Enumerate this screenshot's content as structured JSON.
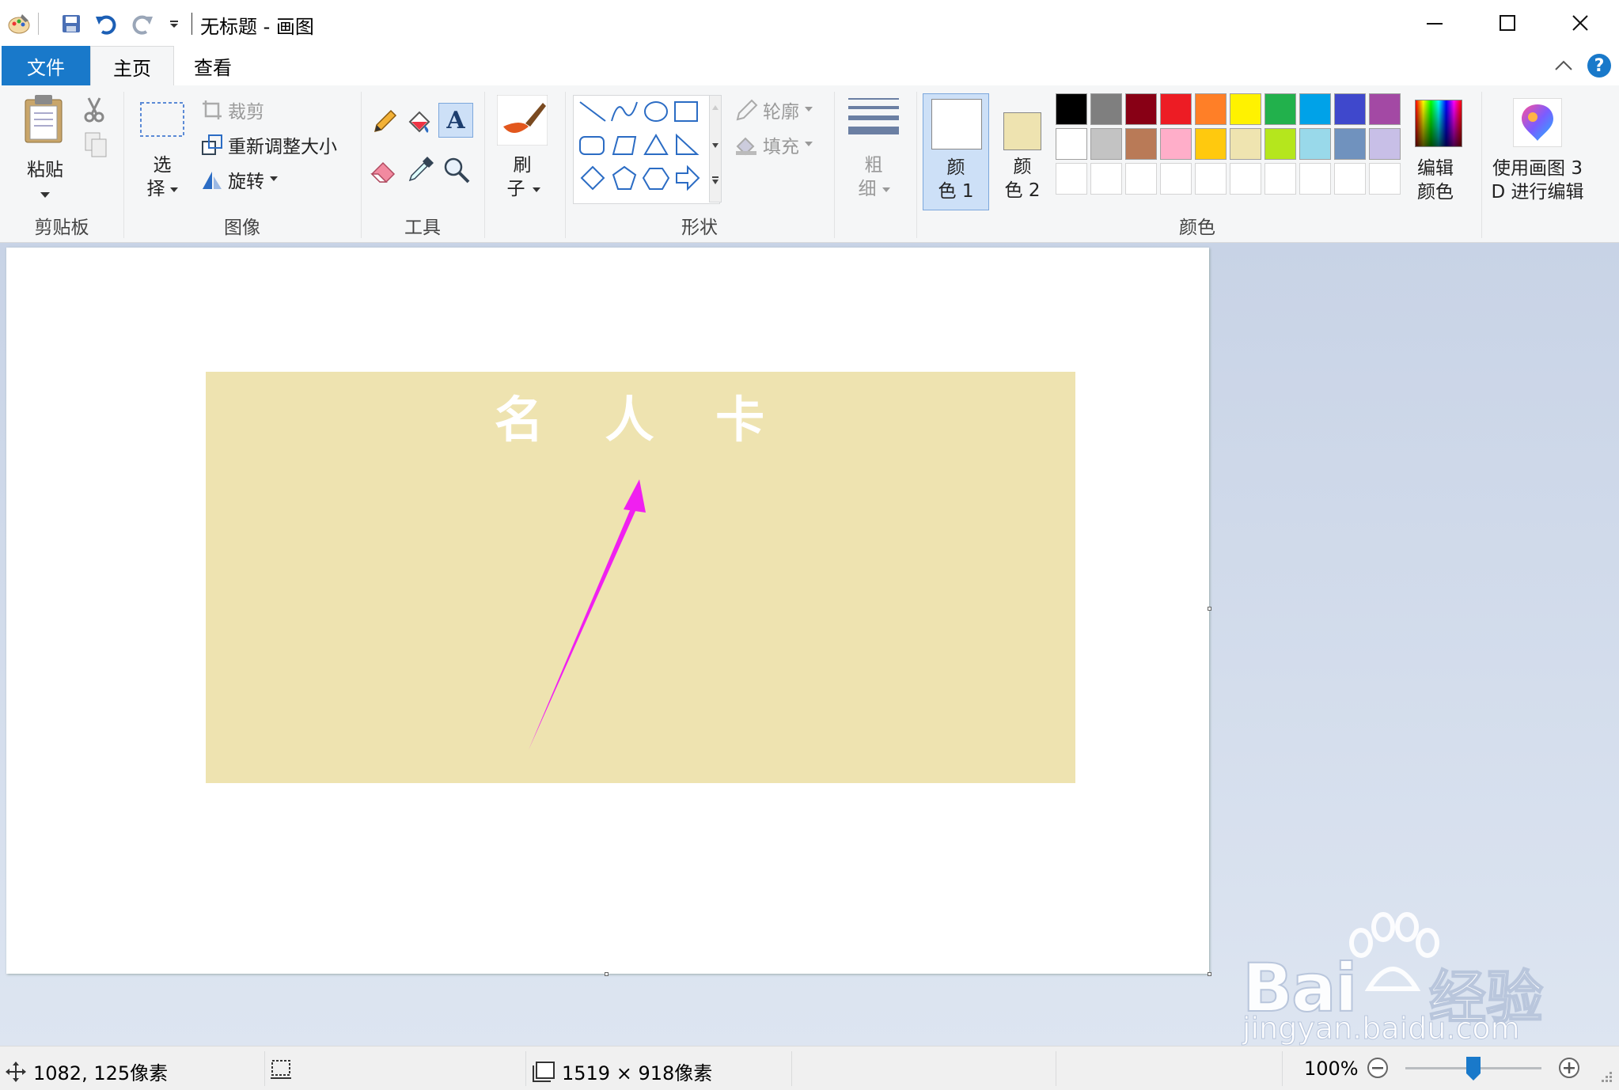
{
  "window": {
    "title": "无标题 - 画图"
  },
  "tabs": {
    "file": "文件",
    "home": "主页",
    "view": "查看"
  },
  "ribbon": {
    "clipboard": {
      "paste": "粘贴",
      "group": "剪贴板"
    },
    "image": {
      "select_1": "选",
      "select_2": "择",
      "crop": "裁剪",
      "resize": "重新调整大小",
      "rotate": "旋转",
      "group": "图像"
    },
    "tools": {
      "group": "工具"
    },
    "brushes": {
      "label_1": "刷",
      "label_2": "子"
    },
    "shapes": {
      "outline": "轮廓",
      "fill": "填充",
      "group": "形状"
    },
    "size": {
      "label_1": "粗",
      "label_2": "细"
    },
    "colors": {
      "color1_1": "颜",
      "color1_2": "色 1",
      "color2_1": "颜",
      "color2_2": "色 2",
      "edit_1": "编辑",
      "edit_2": "颜色",
      "group": "颜色",
      "color1_value": "#ffffff",
      "color2_value": "#eee3b0",
      "palette_row1": [
        "#000000",
        "#7f7f7f",
        "#880015",
        "#ed1c24",
        "#ff7f27",
        "#fff200",
        "#22b14c",
        "#00a2e8",
        "#3f48cc",
        "#a349a4"
      ],
      "palette_row2": [
        "#ffffff",
        "#c3c3c3",
        "#b97a57",
        "#ffaec9",
        "#ffc90e",
        "#efe4b0",
        "#b5e61d",
        "#99d9ea",
        "#7092be",
        "#c8bfe7"
      ],
      "palette_row3": [
        "#ffffff",
        "#ffffff",
        "#ffffff",
        "#ffffff",
        "#ffffff",
        "#ffffff",
        "#ffffff",
        "#ffffff",
        "#ffffff",
        "#ffffff"
      ]
    },
    "paint3d": {
      "label_1": "使用画图 3",
      "label_2": "D 进行编辑"
    }
  },
  "canvas": {
    "card_title": "名 人 卡",
    "card_color": "#eee3b0",
    "arrow_color": "#f020f0"
  },
  "status": {
    "cursor": "1082, 125像素",
    "size": "1519 × 918像素",
    "zoom": "100%",
    "zoom_level": 1.0
  },
  "watermark": {
    "brand": "Bai",
    "brand_cn": "经验",
    "url": "jingyan.baidu.com"
  }
}
